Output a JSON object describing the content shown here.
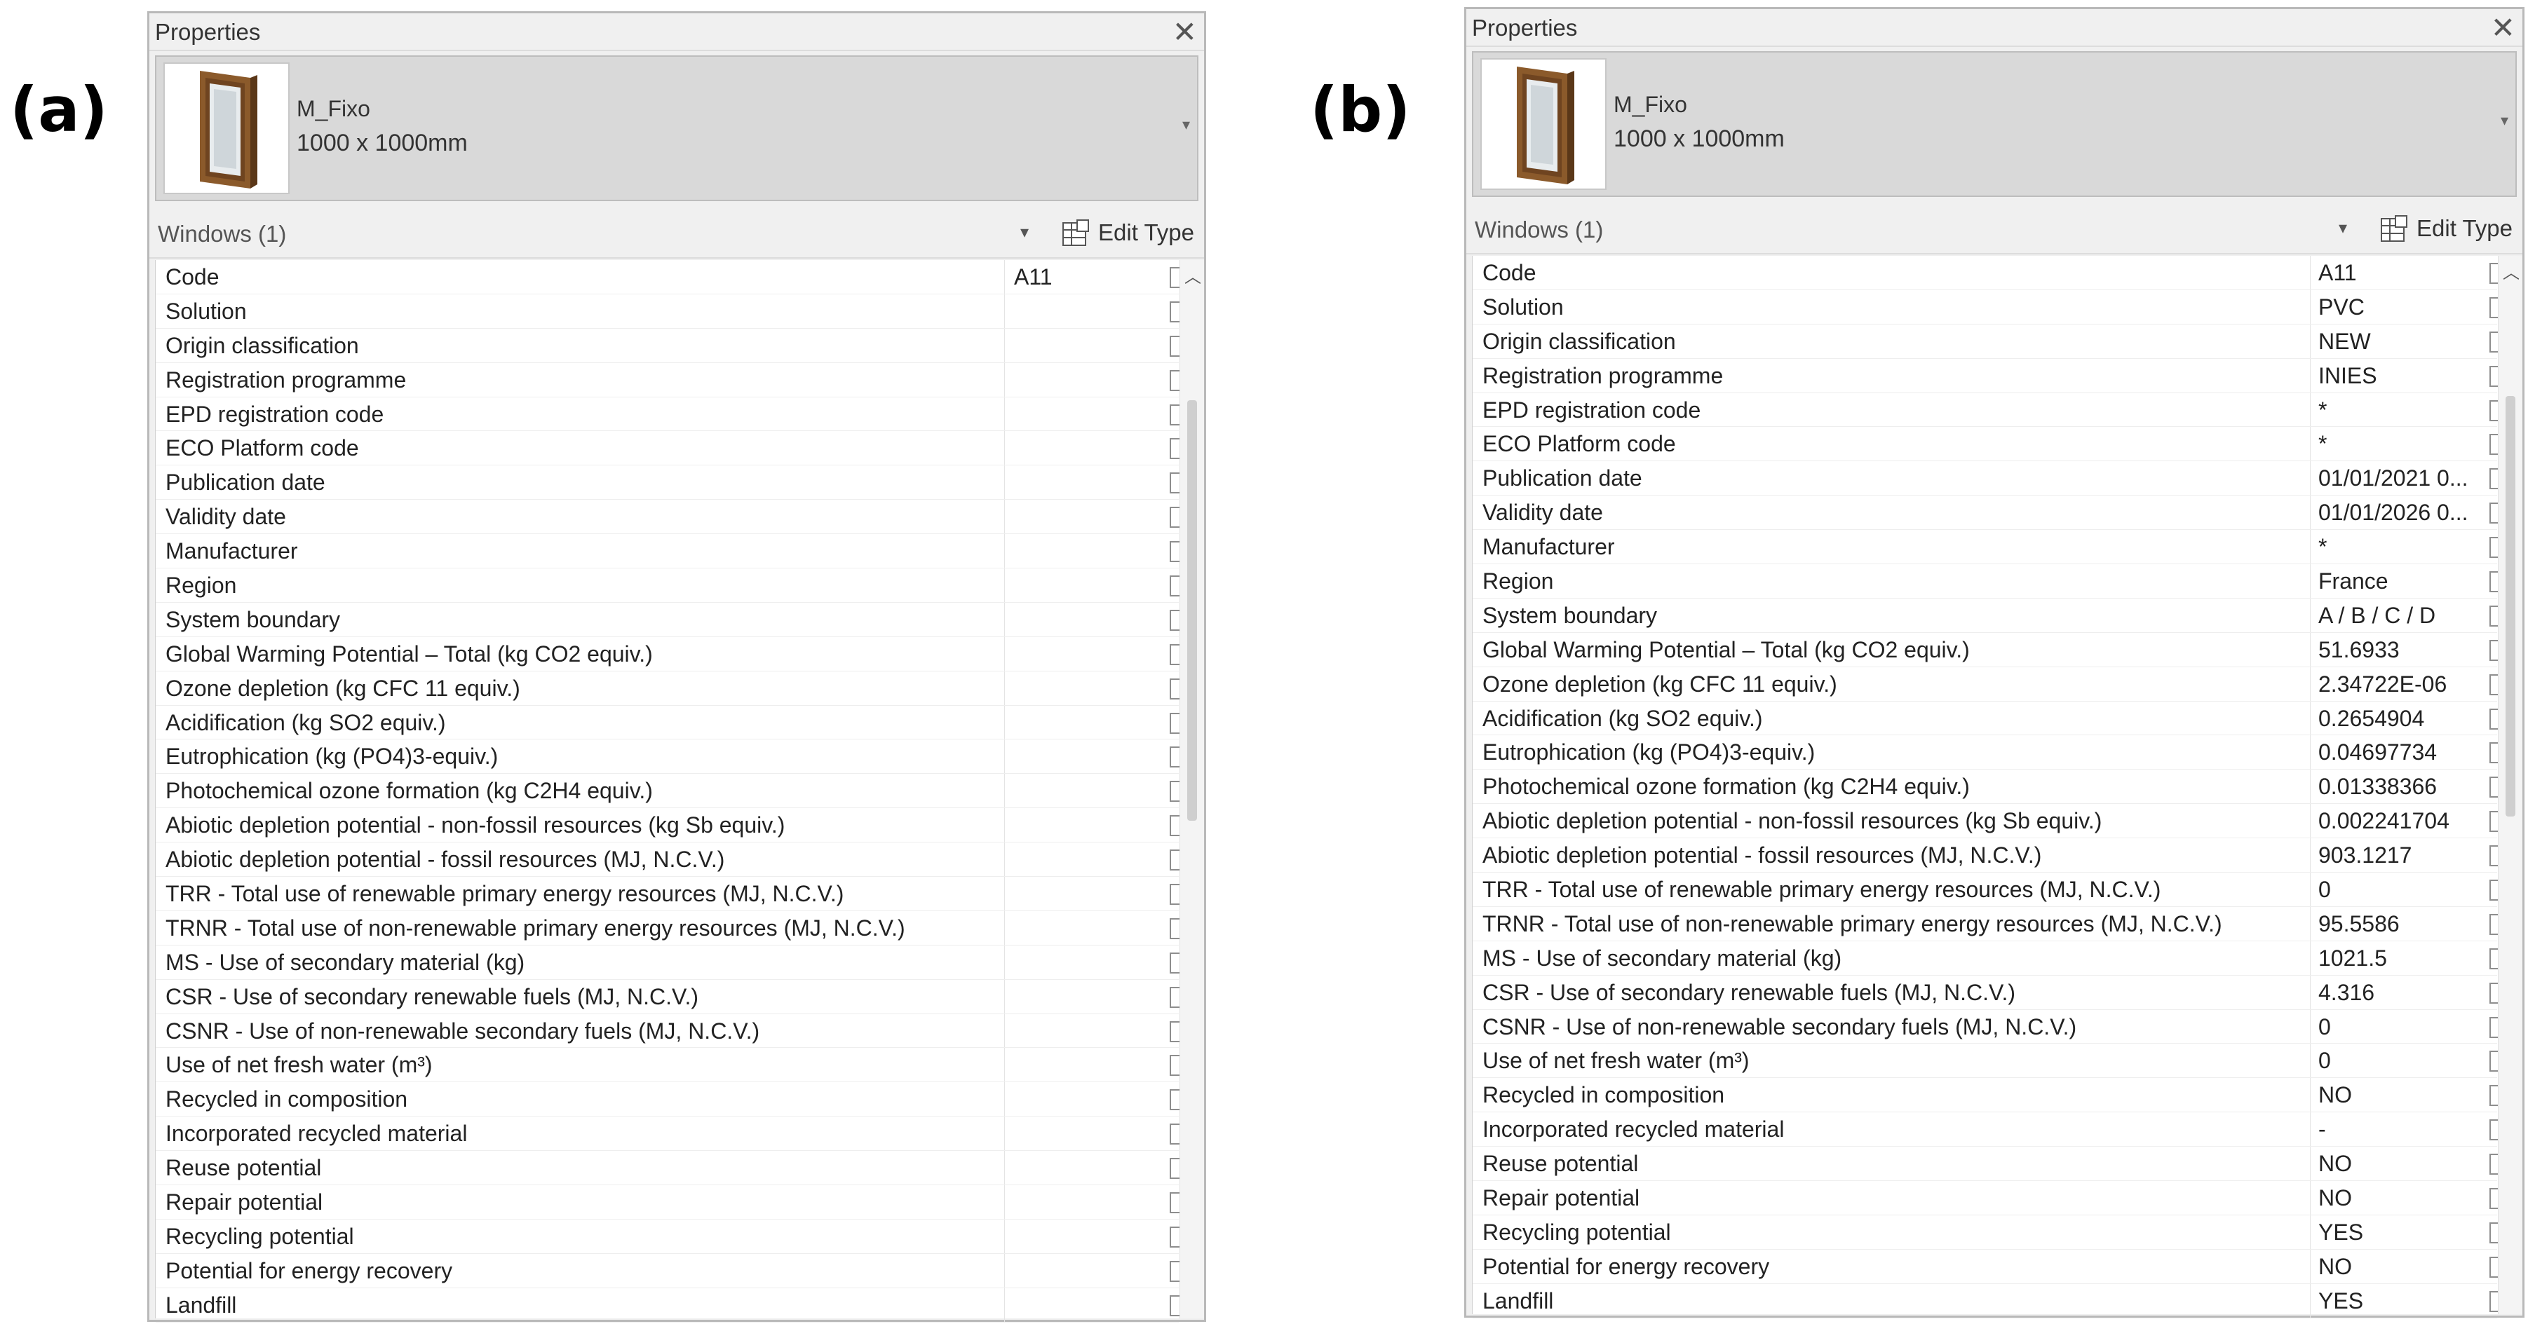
{
  "figure_labels": {
    "a": "(a)",
    "b": "(b)"
  },
  "panel_a": {
    "title": "Properties",
    "close_glyph": "✕",
    "type_name": "M_Fixo",
    "type_size": "1000 x 1000mm",
    "filter": "Windows (1)",
    "edit_type": "Edit Type",
    "rows": [
      {
        "name": "Code",
        "value": "A11"
      },
      {
        "name": "Solution",
        "value": ""
      },
      {
        "name": "Origin classification",
        "value": ""
      },
      {
        "name": "Registration programme",
        "value": ""
      },
      {
        "name": "EPD registration code",
        "value": ""
      },
      {
        "name": "ECO Platform code",
        "value": ""
      },
      {
        "name": "Publication date",
        "value": ""
      },
      {
        "name": "Validity date",
        "value": ""
      },
      {
        "name": "Manufacturer",
        "value": ""
      },
      {
        "name": "Region",
        "value": ""
      },
      {
        "name": "System boundary",
        "value": ""
      },
      {
        "name": "Global Warming Potential – Total (kg CO2 equiv.)",
        "value": ""
      },
      {
        "name": "Ozone depletion (kg CFC 11 equiv.)",
        "value": ""
      },
      {
        "name": "Acidification (kg SO2 equiv.)",
        "value": ""
      },
      {
        "name": "Eutrophication (kg (PO4)3-equiv.)",
        "value": ""
      },
      {
        "name": "Photochemical ozone formation (kg C2H4 equiv.)",
        "value": ""
      },
      {
        "name": "Abiotic depletion potential - non-fossil resources (kg Sb equiv.)",
        "value": ""
      },
      {
        "name": "Abiotic depletion potential - fossil resources (MJ, N.C.V.)",
        "value": ""
      },
      {
        "name": "TRR - Total use of renewable primary energy resources (MJ, N.C.V.)",
        "value": ""
      },
      {
        "name": "TRNR - Total use of non-renewable primary energy resources (MJ, N.C.V.)",
        "value": ""
      },
      {
        "name": "MS - Use of secondary material (kg)",
        "value": ""
      },
      {
        "name": "CSR - Use of secondary renewable fuels (MJ, N.C.V.)",
        "value": ""
      },
      {
        "name": "CSNR - Use of non-renewable secondary fuels (MJ, N.C.V.)",
        "value": ""
      },
      {
        "name": "Use of net fresh water (m³)",
        "value": ""
      },
      {
        "name": "Recycled in composition",
        "value": ""
      },
      {
        "name": "Incorporated recycled material",
        "value": ""
      },
      {
        "name": "Reuse potential",
        "value": ""
      },
      {
        "name": "Repair potential",
        "value": ""
      },
      {
        "name": "Recycling potential",
        "value": ""
      },
      {
        "name": "Potential for energy recovery",
        "value": ""
      },
      {
        "name": "Landfill",
        "value": ""
      }
    ]
  },
  "panel_b": {
    "title": "Properties",
    "close_glyph": "✕",
    "type_name": "M_Fixo",
    "type_size": "1000 x 1000mm",
    "filter": "Windows (1)",
    "edit_type": "Edit Type",
    "rows": [
      {
        "name": "Code",
        "value": "A11"
      },
      {
        "name": "Solution",
        "value": "PVC"
      },
      {
        "name": "Origin classification",
        "value": "NEW"
      },
      {
        "name": "Registration programme",
        "value": "INIES"
      },
      {
        "name": "EPD registration code",
        "value": "*"
      },
      {
        "name": "ECO Platform code",
        "value": "*"
      },
      {
        "name": "Publication date",
        "value": "01/01/2021 0..."
      },
      {
        "name": "Validity date",
        "value": "01/01/2026 0..."
      },
      {
        "name": "Manufacturer",
        "value": "*"
      },
      {
        "name": "Region",
        "value": "France"
      },
      {
        "name": "System boundary",
        "value": "A / B / C / D"
      },
      {
        "name": "Global Warming Potential – Total (kg CO2 equiv.)",
        "value": "51.6933"
      },
      {
        "name": "Ozone depletion (kg CFC 11 equiv.)",
        "value": "2.34722E-06"
      },
      {
        "name": "Acidification (kg SO2 equiv.)",
        "value": "0.2654904"
      },
      {
        "name": "Eutrophication (kg (PO4)3-equiv.)",
        "value": "0.04697734"
      },
      {
        "name": "Photochemical ozone formation (kg C2H4 equiv.)",
        "value": "0.01338366"
      },
      {
        "name": "Abiotic depletion potential - non-fossil resources (kg Sb equiv.)",
        "value": "0.002241704"
      },
      {
        "name": "Abiotic depletion potential - fossil resources (MJ, N.C.V.)",
        "value": "903.1217"
      },
      {
        "name": "TRR - Total use of renewable primary energy resources (MJ, N.C.V.)",
        "value": "0"
      },
      {
        "name": "TRNR - Total use of non-renewable primary energy resources (MJ, N.C.V.)",
        "value": "95.5586"
      },
      {
        "name": "MS - Use of secondary material (kg)",
        "value": "1021.5"
      },
      {
        "name": "CSR - Use of secondary renewable fuels (MJ, N.C.V.)",
        "value": "4.316"
      },
      {
        "name": "CSNR - Use of non-renewable secondary fuels (MJ, N.C.V.)",
        "value": "0"
      },
      {
        "name": "Use of net fresh water (m³)",
        "value": "0"
      },
      {
        "name": "Recycled in composition",
        "value": "NO"
      },
      {
        "name": "Incorporated recycled material",
        "value": "-"
      },
      {
        "name": "Reuse potential",
        "value": "NO"
      },
      {
        "name": "Repair potential",
        "value": "NO"
      },
      {
        "name": "Recycling potential",
        "value": "YES"
      },
      {
        "name": "Potential for energy recovery",
        "value": "NO"
      },
      {
        "name": "Landfill",
        "value": "YES"
      }
    ]
  }
}
